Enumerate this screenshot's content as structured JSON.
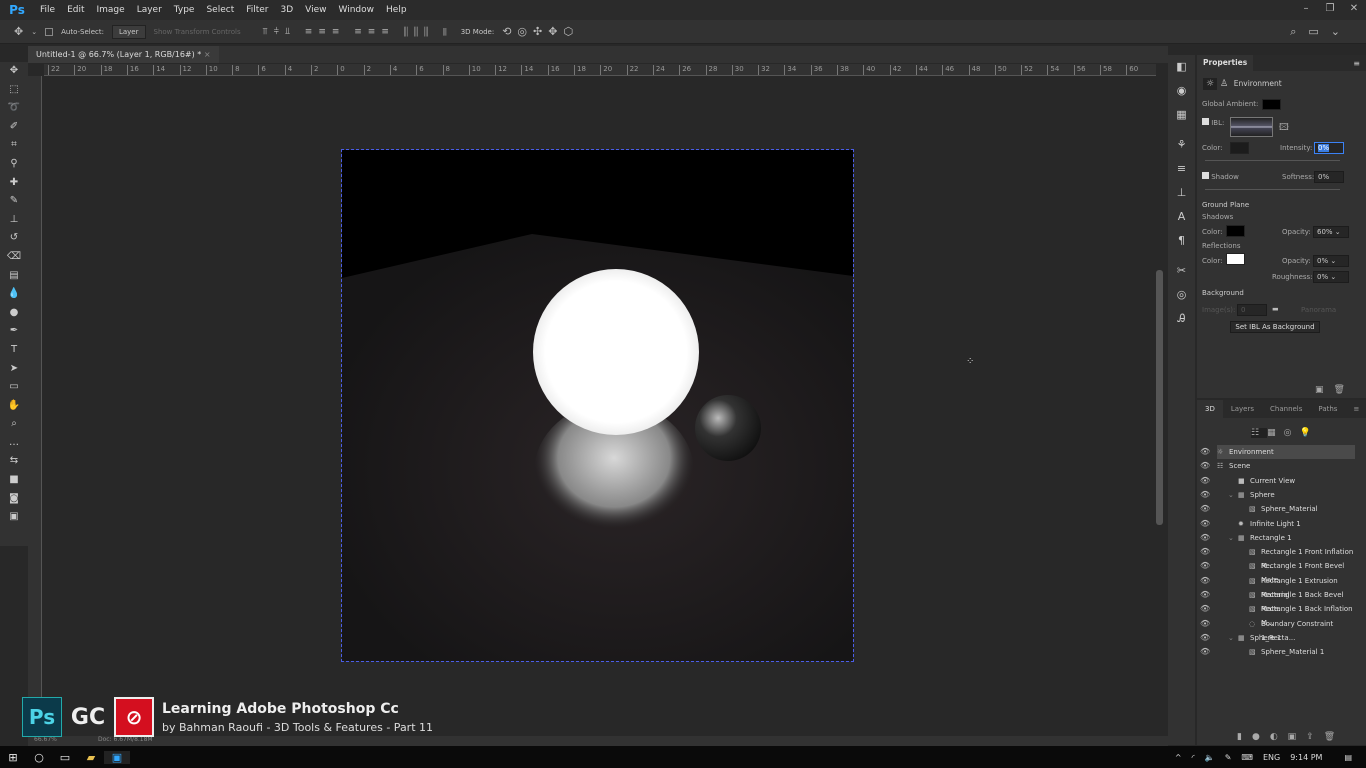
{
  "app": {
    "logo": "Ps",
    "menu": [
      "File",
      "Edit",
      "Image",
      "Layer",
      "Type",
      "Select",
      "Filter",
      "3D",
      "View",
      "Window",
      "Help"
    ],
    "window_controls": [
      "minimize-icon",
      "restore-icon",
      "close-icon"
    ]
  },
  "options": {
    "auto_select_label": "Auto-Select:",
    "auto_select_value": "Layer",
    "show_transform": "Show Transform Controls",
    "mode_3d": "3D Mode:"
  },
  "document_tab": {
    "title": "Untitled-1 @ 66.7% (Layer 1, RGB/16#) *",
    "close": "×"
  },
  "ruler_labels": [
    "22",
    "20",
    "18",
    "16",
    "14",
    "12",
    "10",
    "8",
    "6",
    "4",
    "2",
    "0",
    "2",
    "4",
    "6",
    "8",
    "10",
    "12",
    "14",
    "16",
    "18",
    "20",
    "22",
    "24",
    "26",
    "28",
    "30",
    "32",
    "34",
    "36",
    "38",
    "40",
    "42",
    "44",
    "46",
    "48",
    "50",
    "52",
    "54",
    "56",
    "58",
    "60"
  ],
  "properties": {
    "title": "Properties",
    "section": "Environment",
    "global_ambient": "Global Ambient:",
    "ibl": "IBL:",
    "color": "Color:",
    "intensity_label": "Intensity:",
    "intensity": "0%",
    "shadow": "Shadow",
    "softness_label": "Softness:",
    "softness": "0%",
    "ground_plane": "Ground Plane",
    "shadows": "Shadows",
    "shadow_color": "Color:",
    "shadow_opacity_label": "Opacity:",
    "shadow_opacity": "60%",
    "reflections": "Reflections",
    "refl_color": "Color:",
    "refl_opacity_label": "Opacity:",
    "refl_opacity": "0%",
    "roughness_label": "Roughness:",
    "roughness": "0%",
    "background": "Background",
    "images_label": "Image(s):",
    "images": "0",
    "panorama": "Panorama",
    "set_ibl": "Set IBL As Background",
    "colors": {
      "ambient": "#000000",
      "ibl_color": "#1c1c1c",
      "shadow_color": "#000000",
      "refl_color": "#ffffff"
    }
  },
  "panel3d": {
    "tabs": [
      "3D",
      "Layers",
      "Channels",
      "Paths"
    ],
    "layers": [
      {
        "name": "Environment",
        "indent": 0,
        "icon": "environment-icon",
        "selected": true
      },
      {
        "name": "Scene",
        "indent": 0,
        "icon": "scene-icon"
      },
      {
        "name": "Current View",
        "indent": 1,
        "icon": "camera-icon"
      },
      {
        "name": "Sphere",
        "indent": 1,
        "icon": "mesh-icon",
        "expanded": true
      },
      {
        "name": "Sphere_Material",
        "indent": 2,
        "icon": "material-icon"
      },
      {
        "name": "Infinite Light 1",
        "indent": 1,
        "icon": "light-icon"
      },
      {
        "name": "Rectangle 1",
        "indent": 1,
        "icon": "mesh-icon",
        "expanded": true
      },
      {
        "name": "Rectangle 1 Front Inflation M...",
        "indent": 2,
        "icon": "material-icon"
      },
      {
        "name": "Rectangle 1 Front Bevel Mate...",
        "indent": 2,
        "icon": "material-icon"
      },
      {
        "name": "Rectangle 1 Extrusion Material",
        "indent": 2,
        "icon": "material-icon"
      },
      {
        "name": "Rectangle 1 Back Bevel Mate...",
        "indent": 2,
        "icon": "material-icon"
      },
      {
        "name": "Rectangle 1 Back Inflation M...",
        "indent": 2,
        "icon": "material-icon"
      },
      {
        "name": "Boundary Constraint 1_Recta...",
        "indent": 2,
        "icon": "constraint-icon"
      },
      {
        "name": "Sphere 1",
        "indent": 1,
        "icon": "mesh-icon",
        "expanded": true
      },
      {
        "name": "Sphere_Material 1",
        "indent": 2,
        "icon": "material-icon"
      }
    ]
  },
  "status": {
    "zoom": "66.67%",
    "doc": "Doc: 6.67M/8.18M"
  },
  "banner": {
    "title": "Learning Adobe Photoshop Cc",
    "subtitle": "by Bahman Raoufi - 3D Tools & Features - Part 11",
    "logo_ps": "Ps",
    "logo_gc": "GC"
  },
  "tray": {
    "lang": "ENG",
    "time": "9:14 PM"
  }
}
